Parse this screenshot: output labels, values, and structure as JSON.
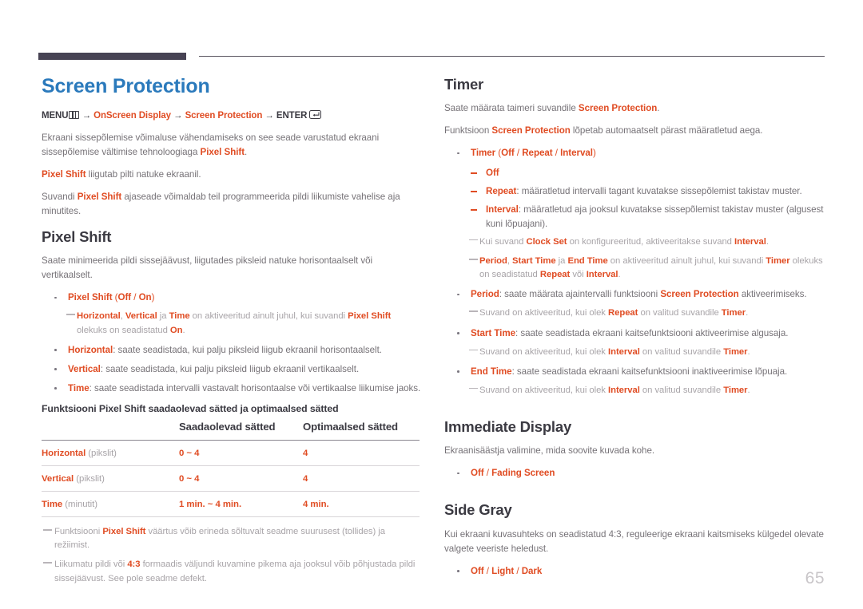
{
  "header": {
    "bar_color": "#474354",
    "line_color": "#58545f"
  },
  "page_number": "65",
  "left_column": {
    "chapter_title": "Screen Protection",
    "menu_path": {
      "menu_label": "MENU",
      "menu_icon": "menu-grid-icon",
      "arrow": "→",
      "item1": "OnScreen Display",
      "item2": "Screen Protection",
      "enter_label": "ENTER",
      "enter_icon": "enter-key-icon"
    },
    "intro_paragraphs": [
      {
        "parts": [
          {
            "t": "Ekraani sissepõlemise võimaluse vähendamiseks on see seade varustatud ekraani sissepõlemise vältimise tehnoloogiaga ",
            "s": "plain"
          },
          {
            "t": "Pixel Shift",
            "s": "hl"
          },
          {
            "t": ".",
            "s": "plain"
          }
        ]
      },
      {
        "parts": [
          {
            "t": "Pixel Shift",
            "s": "hl"
          },
          {
            "t": " liigutab pilti natuke ekraanil.",
            "s": "plain"
          }
        ]
      },
      {
        "parts": [
          {
            "t": "Suvandi ",
            "s": "plain"
          },
          {
            "t": "Pixel Shift",
            "s": "hl"
          },
          {
            "t": " ajaseade võimaldab teil programmeerida pildi liikumiste vahelise aja minutites.",
            "s": "plain"
          }
        ]
      }
    ],
    "pixel_shift": {
      "title": "Pixel Shift",
      "description": "Saate minimeerida pildi sissejäävust, liigutades piksleid natuke horisontaalselt või vertikaalselt.",
      "bullets": [
        {
          "type": "dot",
          "parts": [
            {
              "t": "Pixel Shift",
              "s": "hl"
            },
            {
              "t": " (",
              "s": "hl-plain"
            },
            {
              "t": "Off",
              "s": "hl"
            },
            {
              "t": " / ",
              "s": "hl-plain"
            },
            {
              "t": "On",
              "s": "hl"
            },
            {
              "t": ")",
              "s": "hl-plain"
            }
          ]
        },
        {
          "type": "note1",
          "parts": [
            {
              "t": "Horizontal",
              "s": "hl"
            },
            {
              "t": ", ",
              "s": "plain"
            },
            {
              "t": "Vertical",
              "s": "hl"
            },
            {
              "t": " ja ",
              "s": "plain"
            },
            {
              "t": "Time",
              "s": "hl"
            },
            {
              "t": " on aktiveeritud ainult juhul, kui suvandi ",
              "s": "plain"
            },
            {
              "t": "Pixel Shift",
              "s": "hl"
            },
            {
              "t": " olekuks on seadistatud ",
              "s": "plain"
            },
            {
              "t": "On",
              "s": "hl"
            },
            {
              "t": ".",
              "s": "plain"
            }
          ]
        },
        {
          "type": "dot",
          "parts": [
            {
              "t": "Horizontal",
              "s": "hl"
            },
            {
              "t": ": saate seadistada, kui palju piksleid liigub ekraanil horisontaalselt.",
              "s": "plain"
            }
          ]
        },
        {
          "type": "dot",
          "parts": [
            {
              "t": "Vertical",
              "s": "hl"
            },
            {
              "t": ": saate seadistada, kui palju piksleid liigub ekraanil vertikaalselt.",
              "s": "plain"
            }
          ]
        },
        {
          "type": "dot",
          "parts": [
            {
              "t": "Time",
              "s": "hl"
            },
            {
              "t": ": saate seadistada intervalli vastavalt horisontaalse või vertikaalse liikumise jaoks.",
              "s": "plain"
            }
          ]
        }
      ]
    },
    "table": {
      "title": "Funktsiooni Pixel Shift saadaolevad sätted ja optimaalsed sätted",
      "headers": [
        "",
        "Saadaolevad sätted",
        "Optimaalsed sätted"
      ],
      "rows": [
        {
          "name": "Horizontal",
          "unit": "(pikslit)",
          "available": "0 ~ 4",
          "optimal": "4"
        },
        {
          "name": "Vertical",
          "unit": "(pikslit)",
          "available": "0 ~ 4",
          "optimal": "4"
        },
        {
          "name": "Time",
          "unit": "(minutit)",
          "available": "1 min. ~ 4 min.",
          "optimal": "4 min."
        }
      ]
    },
    "table_notes": [
      {
        "parts": [
          {
            "t": "Funktsiooni ",
            "s": "plain"
          },
          {
            "t": "Pixel Shift",
            "s": "hl"
          },
          {
            "t": " väärtus võib erineda sõltuvalt seadme suurusest (tollides) ja režiimist.",
            "s": "plain"
          }
        ]
      },
      {
        "parts": [
          {
            "t": "Liikumatu pildi või ",
            "s": "plain"
          },
          {
            "t": "4:3",
            "s": "hl"
          },
          {
            "t": " formaadis väljundi kuvamine pikema aja jooksul võib põhjustada pildi sissejäävust. See pole seadme defekt.",
            "s": "plain"
          }
        ]
      }
    ]
  },
  "right_column": {
    "timer": {
      "title": "Timer",
      "paragraphs": [
        {
          "parts": [
            {
              "t": "Saate määrata taimeri suvandile ",
              "s": "plain"
            },
            {
              "t": "Screen Protection",
              "s": "hl"
            },
            {
              "t": ".",
              "s": "plain"
            }
          ]
        },
        {
          "parts": [
            {
              "t": "Funktsioon ",
              "s": "plain"
            },
            {
              "t": "Screen Protection",
              "s": "hl"
            },
            {
              "t": " lõpetab automaatselt pärast määratletud aega.",
              "s": "plain"
            }
          ]
        }
      ],
      "bullets": [
        {
          "type": "dot",
          "parts": [
            {
              "t": "Timer",
              "s": "hl"
            },
            {
              "t": " (",
              "s": "hl-plain"
            },
            {
              "t": "Off",
              "s": "hl"
            },
            {
              "t": " / ",
              "s": "hl-plain"
            },
            {
              "t": "Repeat",
              "s": "hl"
            },
            {
              "t": " / ",
              "s": "hl-plain"
            },
            {
              "t": "Interval",
              "s": "hl"
            },
            {
              "t": ")",
              "s": "hl-plain"
            }
          ]
        },
        {
          "type": "dash",
          "parts": [
            {
              "t": "Off",
              "s": "hl"
            }
          ]
        },
        {
          "type": "dash",
          "parts": [
            {
              "t": "Repeat",
              "s": "hl"
            },
            {
              "t": ": määratletud intervalli tagant kuvatakse sissepõlemist takistav muster.",
              "s": "plain"
            }
          ]
        },
        {
          "type": "dash",
          "parts": [
            {
              "t": "Interval",
              "s": "hl"
            },
            {
              "t": ": määratletud aja jooksul kuvatakse sissepõlemist takistav muster (algusest kuni lõpuajani).",
              "s": "plain"
            }
          ]
        },
        {
          "type": "note1",
          "parts": [
            {
              "t": "Kui suvand ",
              "s": "plain"
            },
            {
              "t": "Clock Set",
              "s": "hl"
            },
            {
              "t": " on konfigureeritud, aktiveeritakse suvand ",
              "s": "plain"
            },
            {
              "t": "Interval",
              "s": "hl"
            },
            {
              "t": ".",
              "s": "plain"
            }
          ]
        },
        {
          "type": "note1",
          "parts": [
            {
              "t": "Period",
              "s": "hl"
            },
            {
              "t": ", ",
              "s": "plain"
            },
            {
              "t": "Start Time",
              "s": "hl"
            },
            {
              "t": " ja ",
              "s": "plain"
            },
            {
              "t": "End Time",
              "s": "hl"
            },
            {
              "t": " on aktiveeritud ainult juhul, kui suvandi ",
              "s": "plain"
            },
            {
              "t": "Timer",
              "s": "hl"
            },
            {
              "t": " olekuks on seadistatud ",
              "s": "plain"
            },
            {
              "t": "Repeat",
              "s": "hl"
            },
            {
              "t": " või ",
              "s": "plain"
            },
            {
              "t": "Interval",
              "s": "hl"
            },
            {
              "t": ".",
              "s": "plain"
            }
          ]
        },
        {
          "type": "dot",
          "parts": [
            {
              "t": "Period",
              "s": "hl"
            },
            {
              "t": ": saate määrata ajaintervalli funktsiooni ",
              "s": "plain"
            },
            {
              "t": "Screen Protection",
              "s": "hl"
            },
            {
              "t": " aktiveerimiseks.",
              "s": "plain"
            }
          ]
        },
        {
          "type": "note2",
          "parts": [
            {
              "t": "Suvand on aktiveeritud, kui olek ",
              "s": "plain"
            },
            {
              "t": "Repeat",
              "s": "hl"
            },
            {
              "t": " on valitud suvandile ",
              "s": "plain"
            },
            {
              "t": "Timer",
              "s": "hl"
            },
            {
              "t": ".",
              "s": "plain"
            }
          ]
        },
        {
          "type": "dot",
          "parts": [
            {
              "t": "Start Time",
              "s": "hl"
            },
            {
              "t": ": saate seadistada ekraani kaitsefunktsiooni aktiveerimise algusaja.",
              "s": "plain"
            }
          ]
        },
        {
          "type": "note2",
          "parts": [
            {
              "t": "Suvand on aktiveeritud, kui olek ",
              "s": "plain"
            },
            {
              "t": "Interval",
              "s": "hl"
            },
            {
              "t": " on valitud suvandile ",
              "s": "plain"
            },
            {
              "t": "Timer",
              "s": "hl"
            },
            {
              "t": ".",
              "s": "plain"
            }
          ]
        },
        {
          "type": "dot",
          "parts": [
            {
              "t": "End Time",
              "s": "hl"
            },
            {
              "t": ": saate seadistada ekraani kaitsefunktsiooni inaktiveerimise lõpuaja.",
              "s": "plain"
            }
          ]
        },
        {
          "type": "note2",
          "parts": [
            {
              "t": "Suvand on aktiveeritud, kui olek ",
              "s": "plain"
            },
            {
              "t": "Interval",
              "s": "hl"
            },
            {
              "t": " on valitud suvandile ",
              "s": "plain"
            },
            {
              "t": "Timer",
              "s": "hl"
            },
            {
              "t": ".",
              "s": "plain"
            }
          ]
        }
      ]
    },
    "immediate_display": {
      "title": "Immediate Display",
      "description": "Ekraanisäästja valimine, mida soovite kuvada kohe.",
      "bullets": [
        {
          "type": "dot",
          "parts": [
            {
              "t": "Off",
              "s": "hl"
            },
            {
              "t": " / ",
              "s": "hl-plain"
            },
            {
              "t": "Fading Screen",
              "s": "hl"
            }
          ]
        }
      ]
    },
    "side_gray": {
      "title": "Side Gray",
      "description": "Kui ekraani kuvasuhteks on seadistatud 4:3, reguleerige ekraani kaitsmiseks külgedel olevate valgete veeriste heledust.",
      "bullets": [
        {
          "type": "dot",
          "parts": [
            {
              "t": "Off",
              "s": "hl"
            },
            {
              "t": " / ",
              "s": "hl-plain"
            },
            {
              "t": "Light",
              "s": "hl"
            },
            {
              "t": " / ",
              "s": "hl-plain"
            },
            {
              "t": "Dark",
              "s": "hl"
            }
          ]
        }
      ]
    }
  }
}
